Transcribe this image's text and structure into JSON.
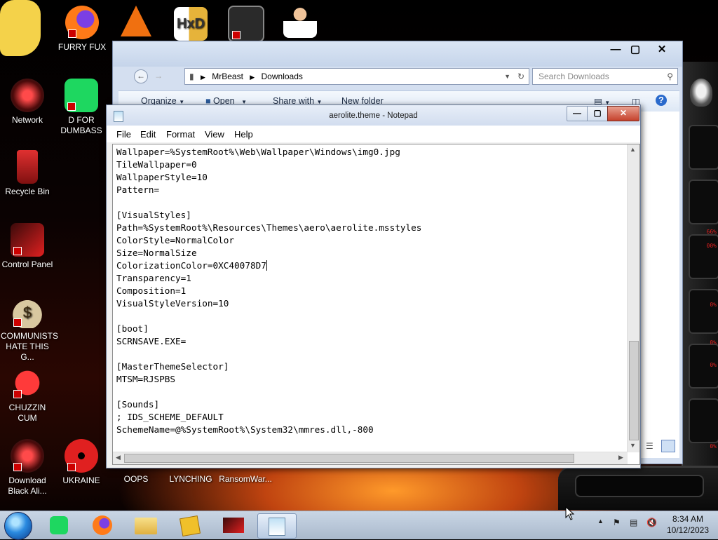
{
  "desktop": {
    "icons": [
      {
        "label": "",
        "color": "#f4d24a"
      },
      {
        "label": "FURRY FUX",
        "color": "#e06a12"
      },
      {
        "label": "",
        "color": "#f07010"
      },
      {
        "label": "",
        "color": "#e6c24a"
      },
      {
        "label": "",
        "color": "#3a3a3a"
      },
      {
        "label": "",
        "color": "#e8c0a0"
      },
      {
        "label": "Network",
        "color": "#a01818"
      },
      {
        "label": "D FOR DUMBASS",
        "color": "#1ed760"
      },
      {
        "label": "Recycle Bin",
        "color": "#c02020"
      },
      {
        "label": "Control Panel",
        "color": "#c01818"
      },
      {
        "label": "COMMUNISTS HATE THIS G...",
        "color": "#d8c8a0"
      },
      {
        "label": "CHUZZIN CUM",
        "color": "#d02020"
      },
      {
        "label": "Download Black Ali...",
        "color": "#a01818"
      },
      {
        "label": "UKRAINE",
        "color": "#e02020"
      },
      {
        "label": "OOPS",
        "color": "#404040"
      },
      {
        "label": "LYNCHING",
        "color": "#404040"
      },
      {
        "label": "RansomWar...",
        "color": "#404040"
      }
    ],
    "alien_readouts": [
      "66%",
      "00%",
      "0%",
      "0%",
      "0%",
      "0%",
      "0%"
    ]
  },
  "explorer": {
    "breadcrumb": [
      "MrBeast",
      "Downloads"
    ],
    "search_placeholder": "Search Downloads",
    "commands": {
      "organize": "Organize",
      "open": "Open",
      "share_with": "Share with",
      "new_folder": "New folder"
    }
  },
  "notepad": {
    "title": "aerolite.theme - Notepad",
    "menus": [
      "File",
      "Edit",
      "Format",
      "View",
      "Help"
    ],
    "text_before_caret": "Wallpaper=%SystemRoot%\\Web\\Wallpaper\\Windows\\img0.jpg\nTileWallpaper=0\nWallpaperStyle=10\nPattern=\n\n[VisualStyles]\nPath=%SystemRoot%\\Resources\\Themes\\aero\\aerolite.msstyles\nColorStyle=NormalColor\nSize=NormalSize\nColorizationColor=0XC40078D7",
    "text_after_caret": "\nTransparency=1\nComposition=1\nVisualStyleVersion=10\n\n[boot]\nSCRNSAVE.EXE=\n\n[MasterThemeSelector]\nMTSM=RJSPBS\n\n[Sounds]\n; IDS_SCHEME_DEFAULT\nSchemeName=@%SystemRoot%\\System32\\mmres.dll,-800"
  },
  "taskbar": {
    "clock_time": "8:34 AM",
    "clock_date": "10/12/2023"
  }
}
